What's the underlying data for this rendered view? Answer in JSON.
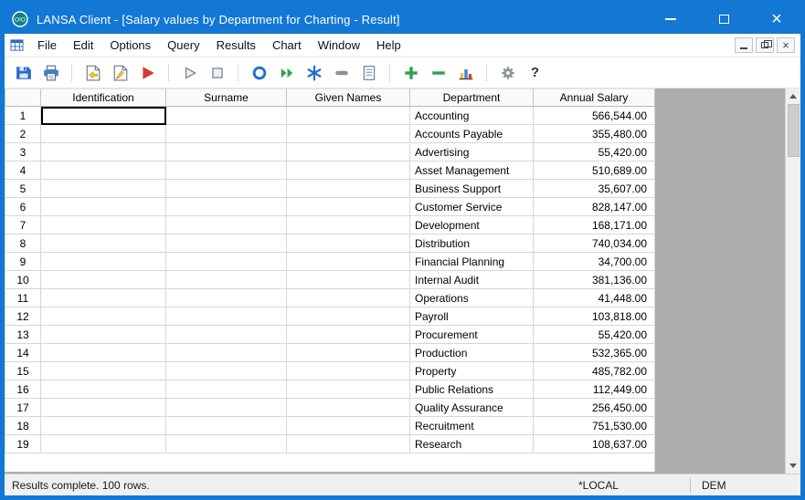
{
  "window": {
    "title": "LANSA Client - [Salary values by Department for Charting - Result]"
  },
  "menu": {
    "items": [
      "File",
      "Edit",
      "Options",
      "Query",
      "Results",
      "Chart",
      "Window",
      "Help"
    ]
  },
  "toolbar": {
    "items": [
      {
        "name": "save-icon"
      },
      {
        "name": "print-icon"
      },
      {
        "sep": true
      },
      {
        "name": "open-report-icon"
      },
      {
        "name": "edit-report-icon"
      },
      {
        "name": "run-query-icon"
      },
      {
        "sep": true
      },
      {
        "name": "run-icon"
      },
      {
        "name": "stop-icon"
      },
      {
        "sep": true
      },
      {
        "name": "record-icon"
      },
      {
        "name": "transfer-icon"
      },
      {
        "name": "freeze-icon"
      },
      {
        "name": "pause-icon"
      },
      {
        "name": "form-icon"
      },
      {
        "sep": true
      },
      {
        "name": "add-row-icon"
      },
      {
        "name": "remove-row-icon"
      },
      {
        "name": "chart-icon"
      },
      {
        "sep": true
      },
      {
        "name": "settings-icon"
      },
      {
        "name": "help-icon"
      }
    ]
  },
  "grid": {
    "columns": [
      "Identification",
      "Surname",
      "Given Names",
      "Department",
      "Annual Salary"
    ],
    "focused_cell": {
      "row": 1,
      "column": "Identification"
    },
    "rows": [
      {
        "num": "1",
        "department": "Accounting",
        "annual_salary": "566,544.00"
      },
      {
        "num": "2",
        "department": "Accounts Payable",
        "annual_salary": "355,480.00"
      },
      {
        "num": "3",
        "department": "Advertising",
        "annual_salary": "55,420.00"
      },
      {
        "num": "4",
        "department": "Asset Management",
        "annual_salary": "510,689.00"
      },
      {
        "num": "5",
        "department": "Business Support",
        "annual_salary": "35,607.00"
      },
      {
        "num": "6",
        "department": "Customer Service",
        "annual_salary": "828,147.00"
      },
      {
        "num": "7",
        "department": "Development",
        "annual_salary": "168,171.00"
      },
      {
        "num": "8",
        "department": "Distribution",
        "annual_salary": "740,034.00"
      },
      {
        "num": "9",
        "department": "Financial Planning",
        "annual_salary": "34,700.00"
      },
      {
        "num": "10",
        "department": "Internal Audit",
        "annual_salary": "381,136.00"
      },
      {
        "num": "11",
        "department": "Operations",
        "annual_salary": "41,448.00"
      },
      {
        "num": "12",
        "department": "Payroll",
        "annual_salary": "103,818.00"
      },
      {
        "num": "13",
        "department": "Procurement",
        "annual_salary": "55,420.00"
      },
      {
        "num": "14",
        "department": "Production",
        "annual_salary": "532,365.00"
      },
      {
        "num": "15",
        "department": "Property",
        "annual_salary": "485,782.00"
      },
      {
        "num": "16",
        "department": "Public Relations",
        "annual_salary": "112,449.00"
      },
      {
        "num": "17",
        "department": "Quality Assurance",
        "annual_salary": "256,450.00"
      },
      {
        "num": "18",
        "department": "Recruitment",
        "annual_salary": "751,530.00"
      },
      {
        "num": "19",
        "department": "Research",
        "annual_salary": "108,637.00"
      }
    ]
  },
  "statusbar": {
    "message": "Results complete. 100 rows.",
    "server": "*LOCAL",
    "user": "DEM"
  },
  "colors": {
    "titlebar": "#1377d4",
    "grid_empty_area": "#adadad",
    "statusbar_bg": "#f0f0f0"
  }
}
